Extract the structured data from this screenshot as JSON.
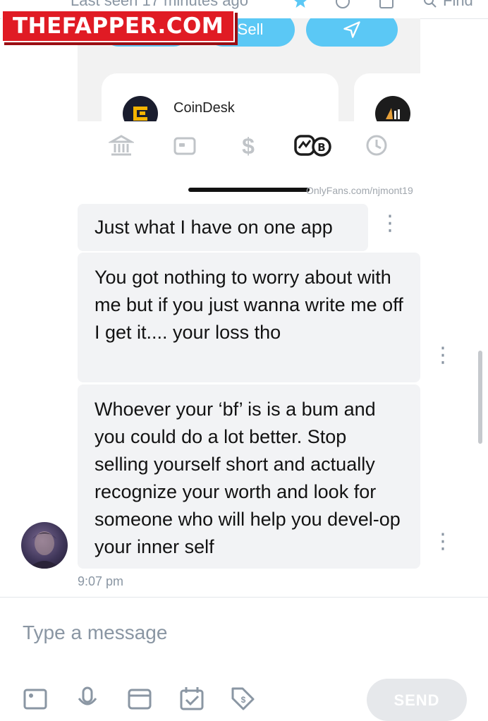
{
  "header": {
    "last_seen": "Last seen 17 minutes ago",
    "find_label": "Find",
    "icons": [
      "star-icon",
      "tag-icon",
      "image-icon",
      "search-icon"
    ]
  },
  "watermark": {
    "logo_text": "THEFAPPER.COM",
    "url_text": "OnlyFans.com/njmont19"
  },
  "embedded_screenshot": {
    "sell_label": "Sell",
    "coin_card_name": "CoinDesk",
    "nav_icons": [
      "bank-icon",
      "card-icon",
      "dollar-icon",
      "bitcoin-icon",
      "clock-icon"
    ]
  },
  "messages": [
    {
      "text": "Just what I have on one app"
    },
    {
      "text": "You got nothing to worry about with me but if you just wanna write me off I get it.... your loss tho"
    },
    {
      "text": "Whoever your ‘bf’ is is a bum and you could do a lot better. Stop selling yourself short and actually recognize your worth and look for someone who will help you devel-op your inner self"
    }
  ],
  "message_time": "9:07 pm",
  "composer": {
    "placeholder": "Type a message",
    "send_label": "SEND",
    "tool_icons": [
      "image-icon",
      "microphone-icon",
      "vault-icon",
      "calendar-icon",
      "price-tag-icon"
    ]
  },
  "colors": {
    "accent": "#5bc8f5",
    "logo_red": "#e01b24",
    "bubble_bg": "#f2f3f5",
    "muted": "#8a96a3"
  }
}
